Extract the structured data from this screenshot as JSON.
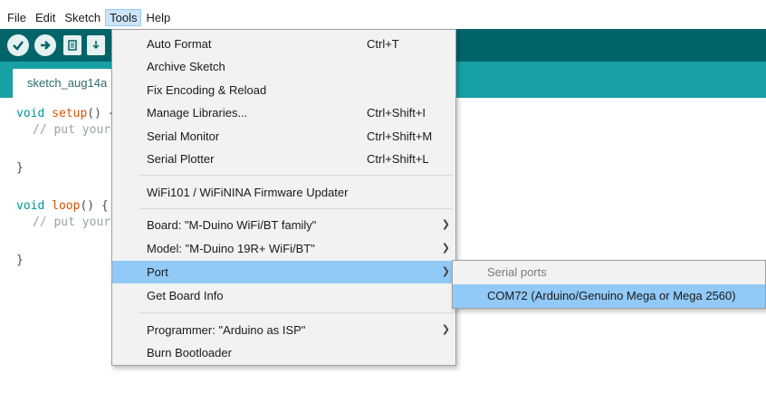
{
  "menubar": {
    "items": [
      "File",
      "Edit",
      "Sketch",
      "Tools",
      "Help"
    ],
    "active": "Tools"
  },
  "tab": {
    "label": "sketch_aug14a"
  },
  "code": {
    "setup_kw": "void",
    "setup_fn": "setup",
    "setup_rest": "() {",
    "setup_comment": "// put your setup code here, to run once:",
    "close1": "}",
    "loop_kw": "void",
    "loop_fn": "loop",
    "loop_rest": "() {",
    "loop_comment": "// put your main code here, to run repeatedly:",
    "close2": "}"
  },
  "tools_menu": {
    "items": [
      {
        "label": "Auto Format",
        "shortcut": "Ctrl+T"
      },
      {
        "label": "Archive Sketch",
        "shortcut": ""
      },
      {
        "label": "Fix Encoding & Reload",
        "shortcut": ""
      },
      {
        "label": "Manage Libraries...",
        "shortcut": "Ctrl+Shift+I"
      },
      {
        "label": "Serial Monitor",
        "shortcut": "Ctrl+Shift+M"
      },
      {
        "label": "Serial Plotter",
        "shortcut": "Ctrl+Shift+L"
      },
      {
        "label": "WiFi101 / WiFiNINA Firmware Updater",
        "shortcut": ""
      },
      {
        "label": "Board: \"M-Duino WiFi/BT family\"",
        "shortcut": ""
      },
      {
        "label": "Model: \"M-Duino 19R+ WiFi/BT\"",
        "shortcut": ""
      },
      {
        "label": "Port",
        "shortcut": ""
      },
      {
        "label": "Get Board Info",
        "shortcut": ""
      },
      {
        "label": "Programmer: \"Arduino as ISP\"",
        "shortcut": ""
      },
      {
        "label": "Burn Bootloader",
        "shortcut": ""
      }
    ],
    "highlighted": "Port"
  },
  "port_submenu": {
    "header": "Serial ports",
    "selected": "COM72 (Arduino/Genuino Mega or Mega 2560)"
  },
  "colors": {
    "toolbar": "#006468",
    "tabstrip": "#17a1a5",
    "highlight": "#91c9f7"
  }
}
